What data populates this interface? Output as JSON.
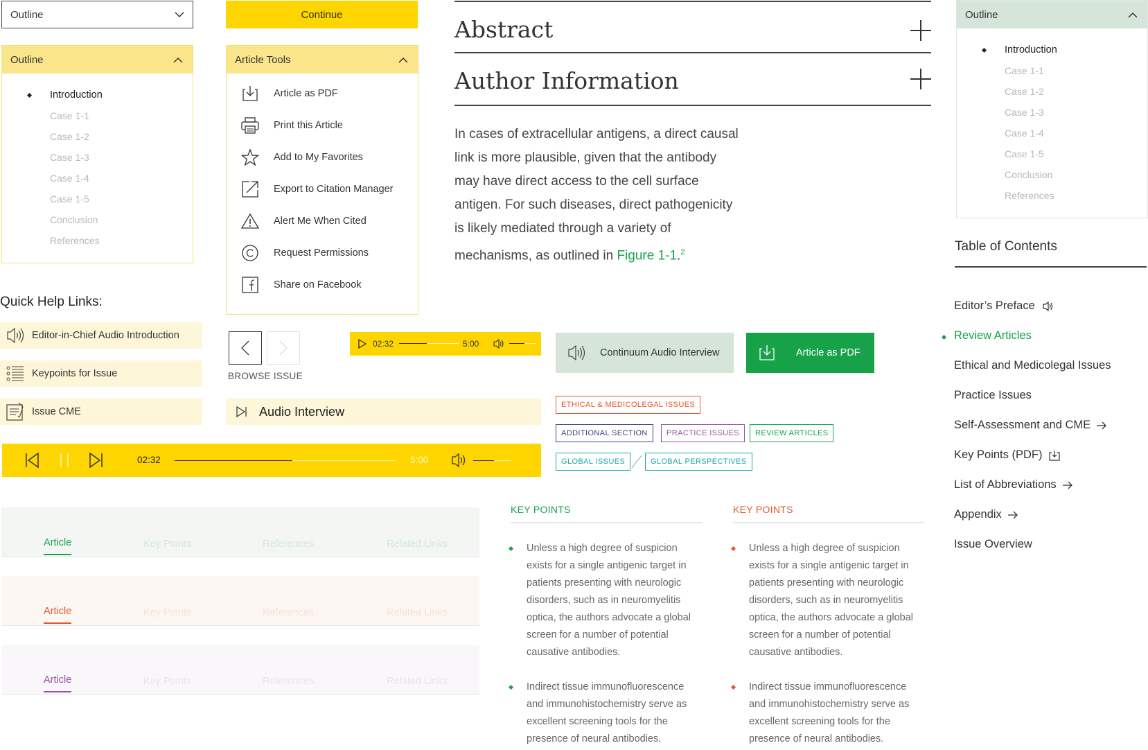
{
  "dropdown": {
    "label": "Outline"
  },
  "continue_button": {
    "label": "Continue"
  },
  "outline_yellow": {
    "title": "Outline",
    "items": [
      "Introduction",
      "Case 1-1",
      "Case 1-2",
      "Case 1-3",
      "Case 1-4",
      "Case 1-5",
      "Conclusion",
      "References"
    ]
  },
  "article_tools": {
    "title": "Article Tools",
    "items": [
      {
        "label": "Article as PDF",
        "icon": "download-icon"
      },
      {
        "label": "Print this Article",
        "icon": "printer-icon"
      },
      {
        "label": "Add to My Favorites",
        "icon": "star-icon"
      },
      {
        "label": "Export to Citation Manager",
        "icon": "export-icon"
      },
      {
        "label": "Alert Me When Cited",
        "icon": "warning-icon"
      },
      {
        "label": "Request Permissions",
        "icon": "copyright-icon"
      },
      {
        "label": "Share on Facebook",
        "icon": "facebook-icon"
      }
    ]
  },
  "accordion": {
    "abstract": "Abstract",
    "author_info": "Author Information"
  },
  "body": {
    "lines": [
      "In cases of extracellular antigens, a direct causal",
      "link is more plausible, given that the antibody",
      "may have direct access to the cell surface",
      "antigen. For such diseases, direct pathogenicity",
      "is likely mediated through a variety of"
    ],
    "last_line_prefix": "mechanisms, as outlined in ",
    "figure_link": "Figure 1-1",
    "last_line_suffix": ".",
    "footnote": "2"
  },
  "outline_green": {
    "title": "Outline",
    "items": [
      "Introduction",
      "Case 1-1",
      "Case 1-2",
      "Case 1-3",
      "Case 1-4",
      "Case 1-5",
      "Conclusion",
      "References"
    ]
  },
  "toc": {
    "title": "Table of Contents",
    "items": [
      {
        "label": "Editor’s Preface",
        "icon": "audio-icon"
      },
      {
        "label": "Review Articles",
        "icon": ""
      },
      {
        "label": "Ethical and Medicolegal Issues",
        "icon": ""
      },
      {
        "label": "Practice Issues",
        "icon": ""
      },
      {
        "label": "Self-Assessment and CME",
        "icon": "arrow-right-icon"
      },
      {
        "label": "Key Points (PDF)",
        "icon": "download-icon"
      },
      {
        "label": "List of Abbreviations",
        "icon": "arrow-right-icon"
      },
      {
        "label": "Appendix",
        "icon": "arrow-right-icon"
      },
      {
        "label": "Issue Overview",
        "icon": ""
      }
    ]
  },
  "quick_help": {
    "title": "Quick Help Links:",
    "items": [
      {
        "label": "Editor-in-Chief Audio Introduction",
        "icon": "audio-icon"
      },
      {
        "label": "Keypoints for Issue",
        "icon": "list-icon"
      },
      {
        "label": "Issue CME",
        "icon": "certificate-icon"
      }
    ]
  },
  "browse": {
    "label": "BROWSE ISSUE"
  },
  "mini_player": {
    "current": "02:32",
    "total": "5:00",
    "progress": 0.46
  },
  "audio_interview_bar": {
    "label": "Audio Interview"
  },
  "continuum_button": {
    "label": "Continuum Audio Interview"
  },
  "pdf_button": {
    "label": "Article as PDF"
  },
  "tags": {
    "ethical": "ETHICAL & MEDICOLEGAL ISSUES",
    "additional": "ADDITIONAL SECTION",
    "practice": "PRACTICE ISSUES",
    "review": "REVIEW ARTICLES",
    "global_issues": "GLOBAL ISSUES",
    "global_perspectives": "GLOBAL PERSPECTIVES"
  },
  "big_player": {
    "current": "02:32",
    "total": "5:00",
    "progress": 0.53
  },
  "tabs": [
    "Article",
    "Key Points",
    "References",
    "Related Links"
  ],
  "colors": {
    "yellow": "#ffd500",
    "green": "#17a24a",
    "orange": "#e2572a",
    "purple": "#9a4fa8"
  },
  "key_points": {
    "heading": "KEY POINTS",
    "items": [
      "Unless a high degree of suspicion exists for a single antigenic target in patients presenting with neurologic disorders, such as in neuromyelitis optica, the authors advocate a global screen for a number of potential causative antibodies.",
      "Indirect tissue immunofluorescence and immunohistochemistry serve as excellent screening tools for the presence of neural antibodies."
    ],
    "item1_lines": [
      "Unless a high degree of suspicion",
      "exists for a single antigenic target in",
      "patients presenting with neurologic",
      "disorders, such as in neuromyelitis",
      "optica, the authors advocate a global",
      "screen for a number of potential",
      "causative antibodies."
    ],
    "item2_lines": [
      "Indirect tissue immunofluorescence",
      "and immunohistochemistry serve as",
      "excellent screening tools for the",
      "presence of neural antibodies."
    ]
  }
}
